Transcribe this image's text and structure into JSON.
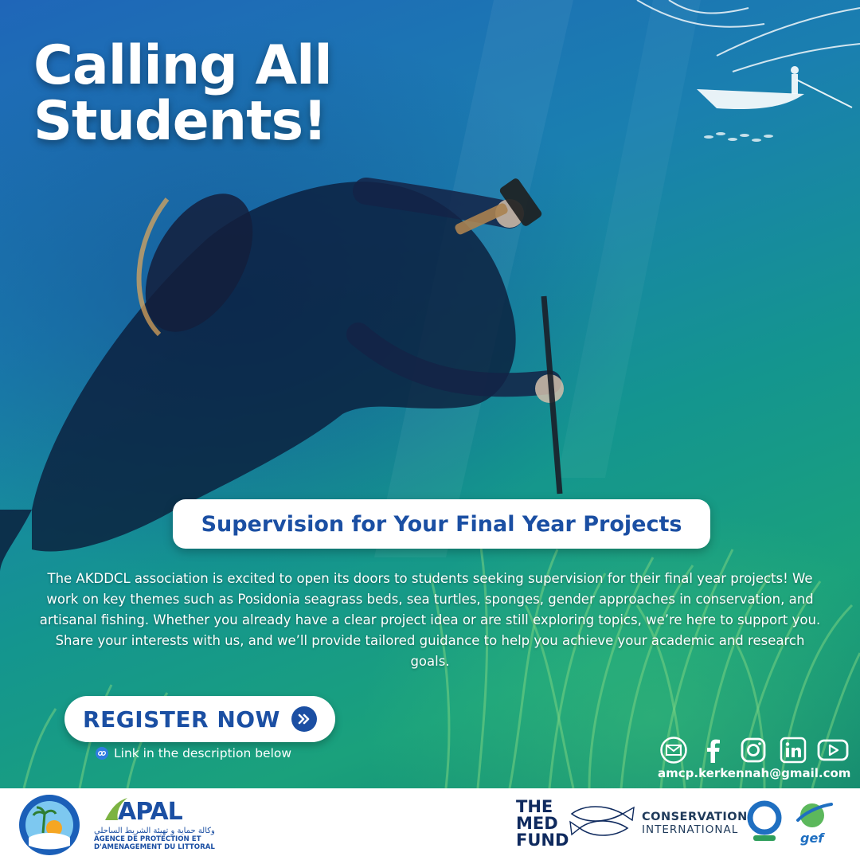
{
  "headline": {
    "line1": "Calling All",
    "line2": "Students!"
  },
  "subtitle": "Supervision for Your Final Year Projects",
  "body": "The AKDDCL association is excited to open its doors to students seeking supervision for their final year projects! We work on key themes such as Posidonia seagrass beds, sea turtles, sponges, gender approaches in conservation, and artisanal fishing. Whether you already have a clear project idea or are still exploring topics, we’re here to support you. Share your interests with us, and we’ll provide tailored guidance to help you achieve your academic and research goals.",
  "cta": {
    "label": "REGISTER NOW",
    "icon": "double-chevron-right-icon"
  },
  "link_note": {
    "text": "Link in the description below",
    "icon": "link-icon"
  },
  "contact": {
    "email": "amcp.kerkennah@gmail.com",
    "socials": [
      "email-icon",
      "facebook-icon",
      "instagram-icon",
      "linkedin-icon",
      "youtube-icon"
    ]
  },
  "footer": {
    "apal": {
      "wordmark": "APAL",
      "arabic": "وكالة حماية و تهيئة الشريط الساحلي",
      "french_line1": "AGENCE DE PROTECTION ET",
      "french_line2": "D'AMENAGEMENT DU LITTORAL"
    },
    "medfund": {
      "line1": "THE",
      "line2": "MED",
      "line3": "FUND"
    },
    "ci": {
      "line1": "CONSERVATION",
      "line2": "INTERNATIONAL"
    },
    "gef": "gef"
  },
  "colors": {
    "brand_blue": "#1b4fa3",
    "water_top": "#1f66b8",
    "water_bottom": "#1aa17c",
    "text_light": "#ffffff"
  }
}
